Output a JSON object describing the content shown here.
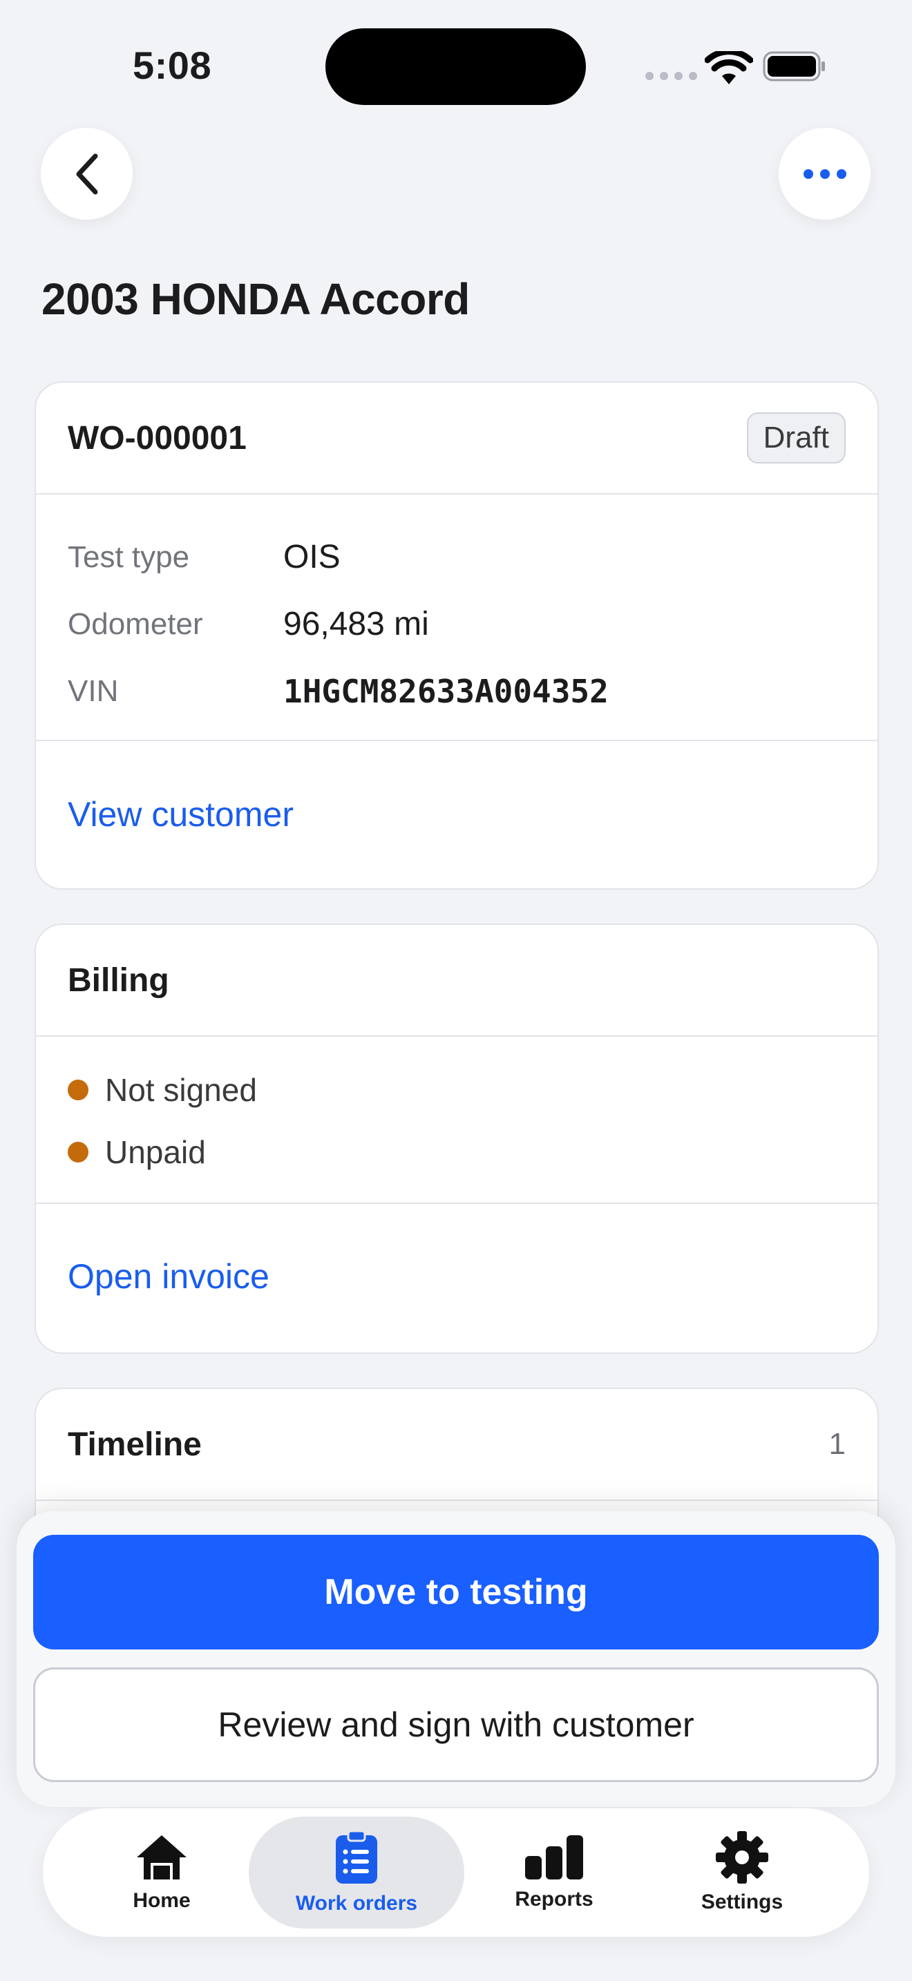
{
  "status_bar": {
    "time": "5:08"
  },
  "header": {
    "title": "2003 HONDA Accord"
  },
  "work_order": {
    "id": "WO-000001",
    "status": "Draft",
    "details": [
      {
        "label": "Test type",
        "value": "OIS"
      },
      {
        "label": "Odometer",
        "value": "96,483 mi"
      },
      {
        "label": "VIN",
        "value": "1HGCM82633A004352"
      }
    ],
    "link": "View customer"
  },
  "billing": {
    "title": "Billing",
    "items": [
      "Not signed",
      "Unpaid"
    ],
    "status_color": "#c46b0c",
    "link": "Open invoice"
  },
  "timeline": {
    "title": "Timeline",
    "count": "1"
  },
  "actions": {
    "primary": "Move to testing",
    "secondary": "Review and sign with customer"
  },
  "tabs": [
    {
      "label": "Home",
      "icon": "home-icon"
    },
    {
      "label": "Work orders",
      "icon": "clipboard-list-icon",
      "active": true
    },
    {
      "label": "Reports",
      "icon": "bar-chart-icon"
    },
    {
      "label": "Settings",
      "icon": "gear-icon"
    }
  ],
  "colors": {
    "accent": "#1a5fff",
    "link": "#1a5ded",
    "background": "#f2f3f7"
  }
}
